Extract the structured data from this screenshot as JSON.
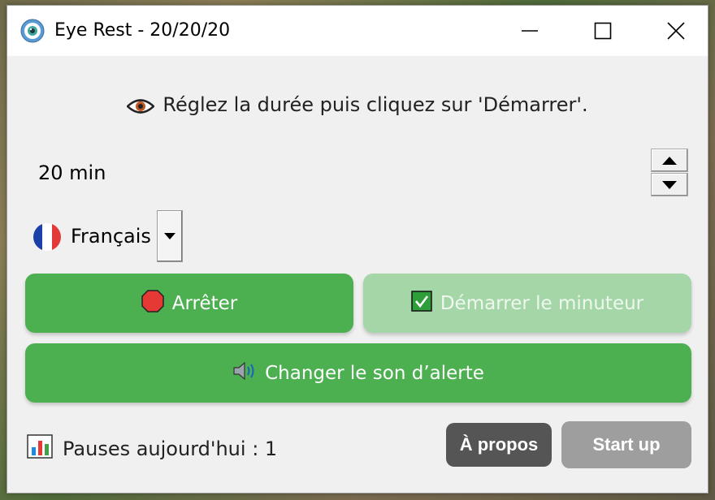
{
  "window": {
    "title": "Eye Rest - 20/20/20",
    "icon": "eye-app-icon",
    "controls": [
      "minimize-icon",
      "maximize-icon",
      "close-icon"
    ]
  },
  "instruction": {
    "icon": "eye-icon",
    "text": "Réglez la durée puis cliquez sur 'Démarrer'."
  },
  "duration": {
    "value": "20 min"
  },
  "language": {
    "flag": "flag-france",
    "selected": "Français"
  },
  "buttons": {
    "stop_label": "Arrêter",
    "stop_icon": "stop-sign-icon",
    "start_label": "Démarrer le minuteur",
    "start_icon": "check-box-icon",
    "sound_label": "Changer le son d’alerte",
    "sound_icon": "speaker-icon",
    "about_label": "À propos",
    "startup_label": "Start up"
  },
  "stats": {
    "icon": "bar-chart-icon",
    "pauses_text": "Pauses aujourd'hui : 1"
  },
  "colors": {
    "primary_green": "#4caf50",
    "disabled_green": "#a5d6a7",
    "about_gray": "#555555",
    "startup_gray": "#9e9e9e"
  }
}
